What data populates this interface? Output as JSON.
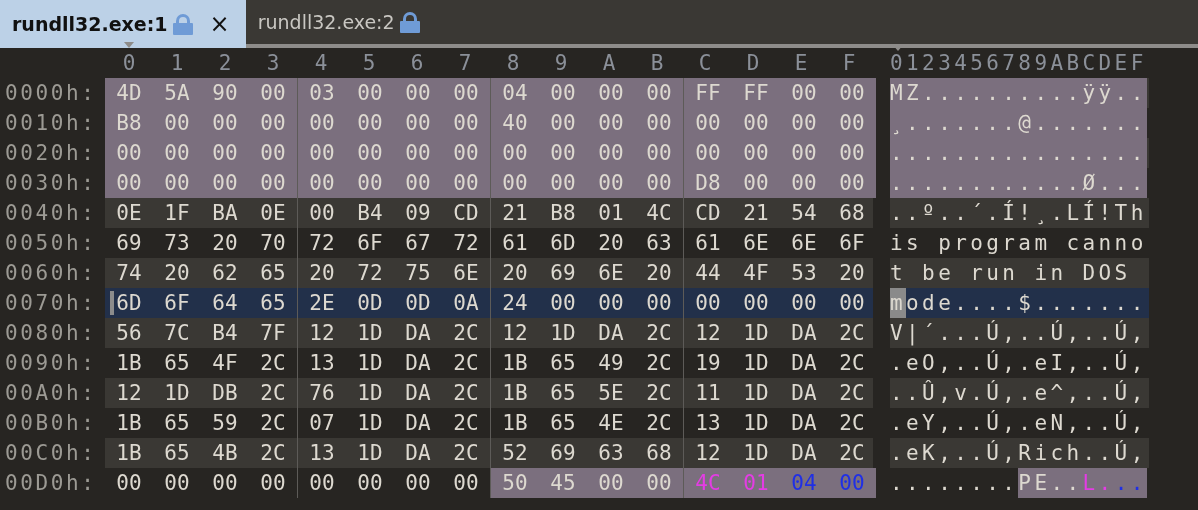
{
  "tabs": [
    {
      "label": "rundll32.exe:1",
      "selected": true,
      "locked": true,
      "close": "×"
    },
    {
      "label": "rundll32.exe:2",
      "selected": false,
      "locked": true
    }
  ],
  "columns": [
    "0",
    "1",
    "2",
    "3",
    "4",
    "5",
    "6",
    "7",
    "8",
    "9",
    "A",
    "B",
    "C",
    "D",
    "E",
    "F"
  ],
  "ascii_header": "0123456789ABCDEF",
  "rows": [
    {
      "offset": "0000h:",
      "selected": false,
      "hex": [
        {
          "bytes": [
            "4D",
            "5A",
            "90",
            "00",
            "03",
            "00",
            "00",
            "00",
            "04",
            "00",
            "00",
            "00",
            "FF",
            "FF",
            "00",
            "00"
          ],
          "highlighted": true
        }
      ],
      "ascii": [
        {
          "text": "MZ..........ÿÿ..",
          "highlighted": true
        }
      ]
    },
    {
      "offset": "0010h:",
      "selected": false,
      "hex": [
        {
          "bytes": [
            "B8",
            "00",
            "00",
            "00",
            "00",
            "00",
            "00",
            "00",
            "40",
            "00",
            "00",
            "00",
            "00",
            "00",
            "00",
            "00"
          ],
          "highlighted": true
        }
      ],
      "ascii": [
        {
          "text": "¸.......@.......",
          "highlighted": true
        }
      ]
    },
    {
      "offset": "0020h:",
      "selected": false,
      "hex": [
        {
          "bytes": [
            "00",
            "00",
            "00",
            "00",
            "00",
            "00",
            "00",
            "00",
            "00",
            "00",
            "00",
            "00",
            "00",
            "00",
            "00",
            "00"
          ],
          "highlighted": true
        }
      ],
      "ascii": [
        {
          "text": "................",
          "highlighted": true
        }
      ]
    },
    {
      "offset": "0030h:",
      "selected": false,
      "hex": [
        {
          "bytes": [
            "00",
            "00",
            "00",
            "00",
            "00",
            "00",
            "00",
            "00",
            "00",
            "00",
            "00",
            "00",
            "D8",
            "00",
            "00",
            "00"
          ],
          "highlighted": true
        }
      ],
      "ascii": [
        {
          "text": "............Ø...",
          "highlighted": true
        }
      ]
    },
    {
      "offset": "0040h:",
      "selected": false,
      "hex": [
        {
          "bytes": [
            "0E",
            "1F",
            "BA",
            "0E",
            "00",
            "B4",
            "09",
            "CD",
            "21",
            "B8",
            "01",
            "4C",
            "CD",
            "21",
            "54",
            "68"
          ],
          "highlighted": false
        }
      ],
      "ascii": [
        {
          "text": "..º..´.Í!¸.LÍ!Th",
          "highlighted": false
        }
      ]
    },
    {
      "offset": "0050h:",
      "selected": false,
      "hex": [
        {
          "bytes": [
            "69",
            "73",
            "20",
            "70",
            "72",
            "6F",
            "67",
            "72",
            "61",
            "6D",
            "20",
            "63",
            "61",
            "6E",
            "6E",
            "6F"
          ],
          "highlighted": false
        }
      ],
      "ascii": [
        {
          "text": "is program canno",
          "highlighted": false
        }
      ]
    },
    {
      "offset": "0060h:",
      "selected": false,
      "hex": [
        {
          "bytes": [
            "74",
            "20",
            "62",
            "65",
            "20",
            "72",
            "75",
            "6E",
            "20",
            "69",
            "6E",
            "20",
            "44",
            "4F",
            "53",
            "20"
          ],
          "highlighted": false
        }
      ],
      "ascii": [
        {
          "text": "t be run in DOS ",
          "highlighted": false
        }
      ]
    },
    {
      "offset": "0070h:",
      "selected": true,
      "hex": [
        {
          "bytes": [
            "6D"
          ],
          "highlighted": false,
          "cursor": true
        },
        {
          "bytes": [
            "6F",
            "64",
            "65",
            "2E",
            "0D",
            "0D",
            "0A",
            "24",
            "00",
            "00",
            "00",
            "00",
            "00",
            "00",
            "00"
          ],
          "highlighted": false
        }
      ],
      "ascii": [
        {
          "text": "m",
          "highlighted": false,
          "cursor": true
        },
        {
          "text": "ode....$.......",
          "highlighted": false
        }
      ]
    },
    {
      "offset": "0080h:",
      "selected": false,
      "hex": [
        {
          "bytes": [
            "56",
            "7C",
            "B4",
            "7F",
            "12",
            "1D",
            "DA",
            "2C",
            "12",
            "1D",
            "DA",
            "2C",
            "12",
            "1D",
            "DA",
            "2C"
          ],
          "highlighted": false
        }
      ],
      "ascii": [
        {
          "text": "V|´...Ú,..Ú,..Ú,",
          "highlighted": false
        }
      ]
    },
    {
      "offset": "0090h:",
      "selected": false,
      "hex": [
        {
          "bytes": [
            "1B",
            "65",
            "4F",
            "2C",
            "13",
            "1D",
            "DA",
            "2C",
            "1B",
            "65",
            "49",
            "2C",
            "19",
            "1D",
            "DA",
            "2C"
          ],
          "highlighted": false
        }
      ],
      "ascii": [
        {
          "text": ".eO,..Ú,.eI,..Ú,",
          "highlighted": false
        }
      ]
    },
    {
      "offset": "00A0h:",
      "selected": false,
      "hex": [
        {
          "bytes": [
            "12",
            "1D",
            "DB",
            "2C",
            "76",
            "1D",
            "DA",
            "2C",
            "1B",
            "65",
            "5E",
            "2C",
            "11",
            "1D",
            "DA",
            "2C"
          ],
          "highlighted": false
        }
      ],
      "ascii": [
        {
          "text": "..Û,v.Ú,.e^,..Ú,",
          "highlighted": false
        }
      ]
    },
    {
      "offset": "00B0h:",
      "selected": false,
      "hex": [
        {
          "bytes": [
            "1B",
            "65",
            "59",
            "2C",
            "07",
            "1D",
            "DA",
            "2C",
            "1B",
            "65",
            "4E",
            "2C",
            "13",
            "1D",
            "DA",
            "2C"
          ],
          "highlighted": false
        }
      ],
      "ascii": [
        {
          "text": ".eY,..Ú,.eN,..Ú,",
          "highlighted": false
        }
      ]
    },
    {
      "offset": "00C0h:",
      "selected": false,
      "hex": [
        {
          "bytes": [
            "1B",
            "65",
            "4B",
            "2C",
            "13",
            "1D",
            "DA",
            "2C",
            "52",
            "69",
            "63",
            "68",
            "12",
            "1D",
            "DA",
            "2C"
          ],
          "highlighted": false
        }
      ],
      "ascii": [
        {
          "text": ".eK,..Ú,Rich..Ú,",
          "highlighted": false
        }
      ]
    },
    {
      "offset": "00D0h:",
      "selected": false,
      "hex": [
        {
          "bytes": [
            "00",
            "00",
            "00",
            "00",
            "00",
            "00",
            "00",
            "00"
          ],
          "highlighted": false
        },
        {
          "bytes": [
            "50",
            "45",
            "00",
            "00"
          ],
          "highlighted": true
        },
        {
          "bytes": [
            "4C",
            "01"
          ],
          "highlighted": true,
          "color": "#e43ce4"
        },
        {
          "bytes": [
            "04",
            "00"
          ],
          "highlighted": true,
          "color": "#1f2fe6"
        }
      ],
      "ascii": [
        {
          "text": "........",
          "highlighted": false
        },
        {
          "text": "PE..",
          "highlighted": true
        },
        {
          "text": "L.",
          "highlighted": true,
          "color": "#e43ce4"
        },
        {
          "text": "..",
          "highlighted": true,
          "color": "#1f2fe6"
        }
      ]
    }
  ]
}
